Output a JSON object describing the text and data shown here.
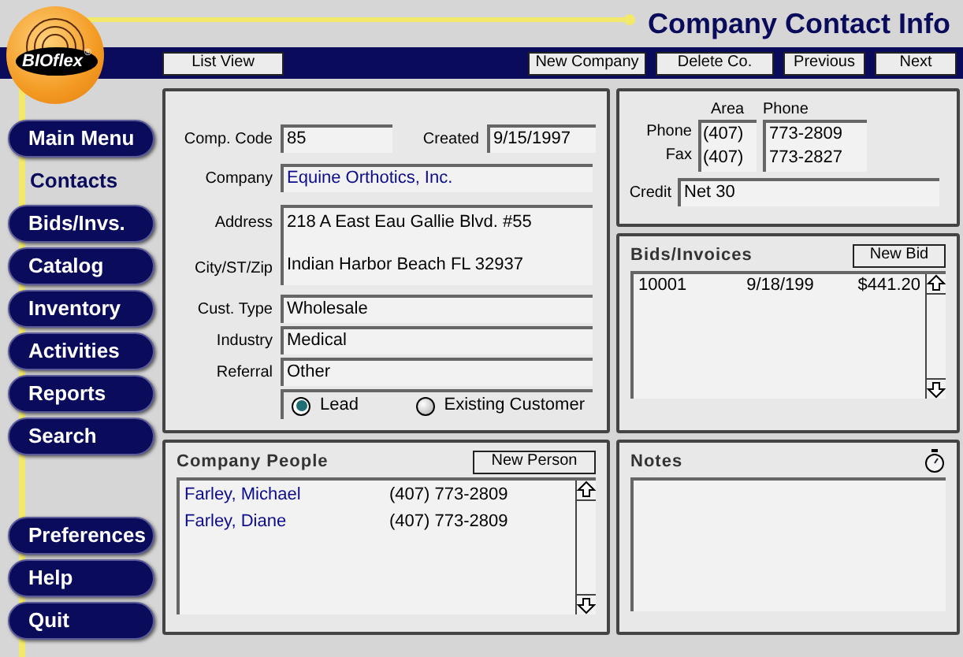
{
  "window": {
    "title": "Company Contact Info"
  },
  "logo": {
    "text": "BIOflex",
    "mark": "®"
  },
  "toolbar": {
    "left_buttons": [
      "List View"
    ],
    "right_buttons": [
      "New Company",
      "Delete Co.",
      "Previous",
      "Next"
    ]
  },
  "sidebar": {
    "items": [
      {
        "label": "Main Menu",
        "selected": false
      },
      {
        "label": "Contacts",
        "selected": true
      },
      {
        "label": "Bids/Invs.",
        "selected": false
      },
      {
        "label": "Catalog",
        "selected": false
      },
      {
        "label": "Inventory",
        "selected": false
      },
      {
        "label": "Activities",
        "selected": false
      },
      {
        "label": "Reports",
        "selected": false
      },
      {
        "label": "Search",
        "selected": false
      }
    ],
    "bottom_items": [
      {
        "label": "Preferences",
        "selected": false
      },
      {
        "label": "Help",
        "selected": false
      },
      {
        "label": "Quit",
        "selected": false
      }
    ]
  },
  "company": {
    "comp_code": {
      "label": "Comp. Code",
      "value": "85"
    },
    "created": {
      "label": "Created",
      "value": "9/15/1997"
    },
    "company": {
      "label": "Company",
      "value": "Equine Orthotics, Inc."
    },
    "address": {
      "label": "Address",
      "value": "218 A East Eau Gallie Blvd. #55"
    },
    "city": {
      "label": "City/ST/Zip",
      "value": "Indian Harbor Beach  FL  32937"
    },
    "fields": [
      {
        "label": "Cust. Type",
        "value": "Wholesale"
      },
      {
        "label": "Industry",
        "value": "Medical"
      },
      {
        "label": "Referral",
        "value": "Other"
      }
    ],
    "status_options": [
      {
        "label": "Lead",
        "selected": true
      },
      {
        "label": "Existing Customer",
        "selected": false
      }
    ]
  },
  "phones": {
    "headers": [
      "Area",
      "Phone"
    ],
    "rows": [
      {
        "label": "Phone",
        "area": "(407)",
        "number": "773-2809"
      },
      {
        "label": "Fax",
        "area": "(407)",
        "number": "773-2827"
      }
    ],
    "credit": {
      "label": "Credit",
      "value": "Net 30"
    }
  },
  "bids": {
    "title": "Bids/Invoices",
    "button": "New Bid",
    "rows": [
      {
        "number": "10001",
        "date": "9/18/199",
        "amount": "$441.20"
      }
    ]
  },
  "people": {
    "title": "Company People",
    "button": "New Person",
    "rows": [
      {
        "name": "Farley, Michael",
        "phone": "(407) 773-2809"
      },
      {
        "name": "Farley, Diane",
        "phone": "(407) 773-2809"
      }
    ]
  },
  "notes": {
    "title": "Notes"
  }
}
